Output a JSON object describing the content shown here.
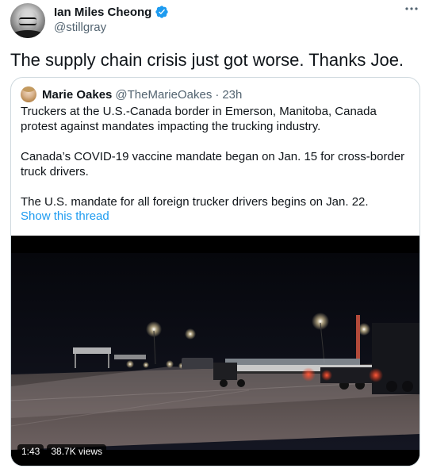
{
  "author": {
    "display_name": "Ian Miles Cheong",
    "handle": "@stillgray",
    "verified": true,
    "avatar_icon": "person-avatar"
  },
  "tweet": {
    "text": "The supply chain crisis just got worse. Thanks Joe."
  },
  "quoted": {
    "display_name": "Marie Oakes",
    "handle": "@TheMarieOakes",
    "separator": "·",
    "time": "23h",
    "paragraphs": [
      "Truckers at the U.S.-Canada border in Emerson, Manitoba, Canada protest against mandates impacting the trucking industry.",
      "Canada’s COVID-19 vaccine mandate began on Jan. 15 for cross-border truck drivers.",
      "The U.S. mandate for all foreign trucker drivers begins on Jan. 22."
    ],
    "show_thread_label": "Show this thread"
  },
  "video": {
    "duration": "1:43",
    "views": "38.7K views"
  },
  "colors": {
    "link": "#1d9bf0",
    "secondary_text": "#536471",
    "verified_badge": "#1d9bf0",
    "border": "#cfd9de"
  },
  "icons": {
    "more": "more-horizontal-icon",
    "verified": "verified-badge-icon"
  }
}
